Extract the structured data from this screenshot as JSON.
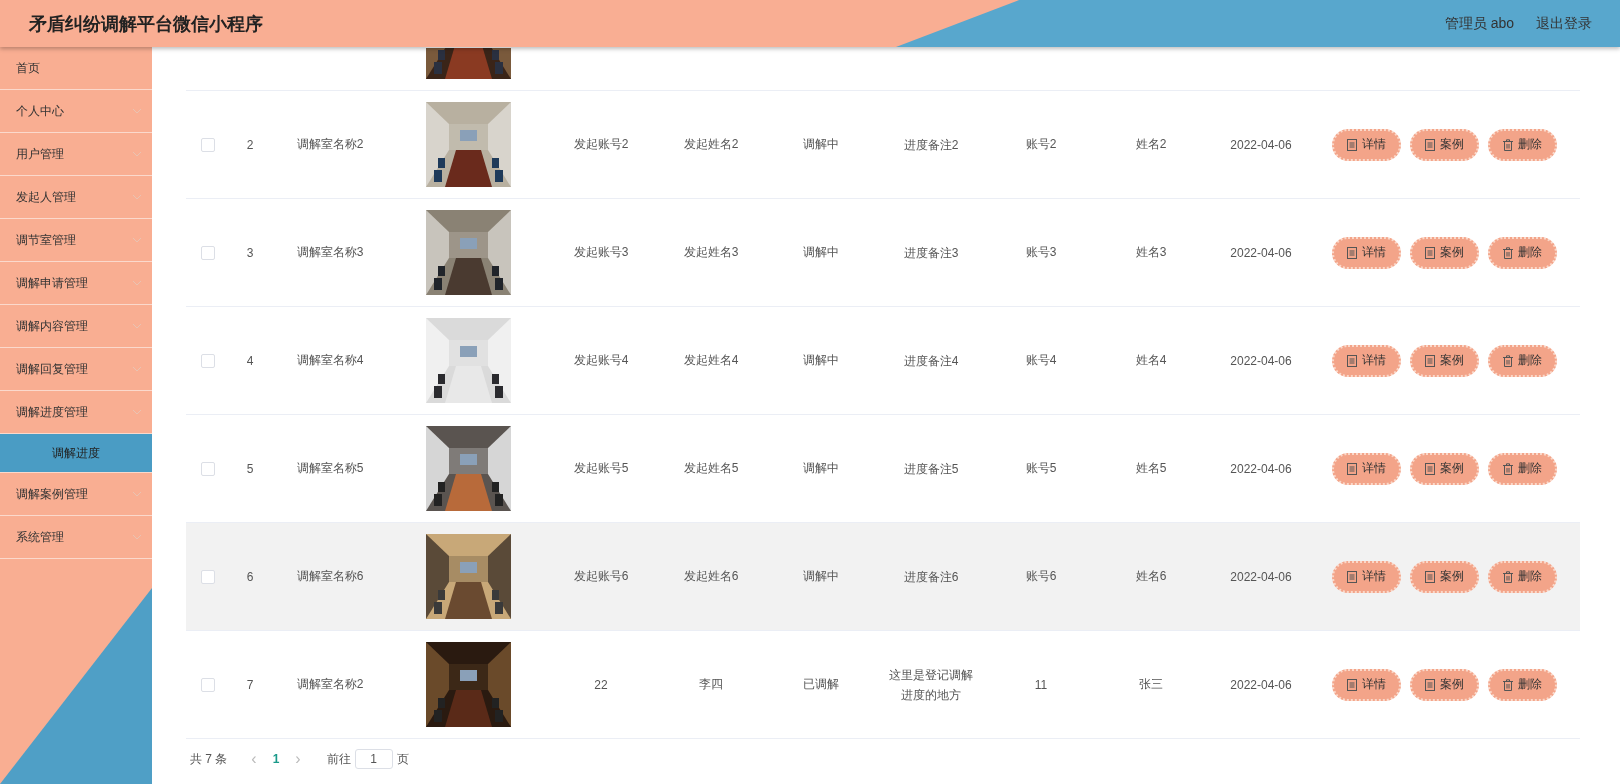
{
  "header": {
    "title": "矛盾纠纷调解平台微信小程序",
    "user": "管理员 abo",
    "logout": "退出登录"
  },
  "sidebar": {
    "items": [
      {
        "label": "首页",
        "expandable": false,
        "selected": false
      },
      {
        "label": "个人中心",
        "expandable": true,
        "selected": false
      },
      {
        "label": "用户管理",
        "expandable": true,
        "selected": false
      },
      {
        "label": "发起人管理",
        "expandable": true,
        "selected": false
      },
      {
        "label": "调节室管理",
        "expandable": true,
        "selected": false
      },
      {
        "label": "调解申请管理",
        "expandable": true,
        "selected": false
      },
      {
        "label": "调解内容管理",
        "expandable": true,
        "selected": false
      },
      {
        "label": "调解回复管理",
        "expandable": true,
        "selected": false
      },
      {
        "label": "调解进度管理",
        "expandable": true,
        "selected": false,
        "children": [
          {
            "label": "调解进度",
            "selected": true
          }
        ]
      },
      {
        "label": "调解案例管理",
        "expandable": true,
        "selected": false
      },
      {
        "label": "系统管理",
        "expandable": true,
        "selected": false
      }
    ]
  },
  "table": {
    "rows": [
      {
        "checked": false,
        "highlighted": false,
        "index": "2",
        "room": "调解室名称2",
        "initiator_account": "发起账号2",
        "initiator_name": "发起姓名2",
        "status": "调解中",
        "note": "进度备注2",
        "account": "账号2",
        "name": "姓名2",
        "date": "2022-04-06",
        "actions": [
          "详情",
          "案例",
          "删除"
        ]
      },
      {
        "checked": false,
        "highlighted": false,
        "index": "3",
        "room": "调解室名称3",
        "initiator_account": "发起账号3",
        "initiator_name": "发起姓名3",
        "status": "调解中",
        "note": "进度备注3",
        "account": "账号3",
        "name": "姓名3",
        "date": "2022-04-06",
        "actions": [
          "详情",
          "案例",
          "删除"
        ]
      },
      {
        "checked": false,
        "highlighted": false,
        "index": "4",
        "room": "调解室名称4",
        "initiator_account": "发起账号4",
        "initiator_name": "发起姓名4",
        "status": "调解中",
        "note": "进度备注4",
        "account": "账号4",
        "name": "姓名4",
        "date": "2022-04-06",
        "actions": [
          "详情",
          "案例",
          "删除"
        ]
      },
      {
        "checked": false,
        "highlighted": false,
        "index": "5",
        "room": "调解室名称5",
        "initiator_account": "发起账号5",
        "initiator_name": "发起姓名5",
        "status": "调解中",
        "note": "进度备注5",
        "account": "账号5",
        "name": "姓名5",
        "date": "2022-04-06",
        "actions": [
          "详情",
          "案例",
          "删除"
        ]
      },
      {
        "checked": false,
        "highlighted": true,
        "index": "6",
        "room": "调解室名称6",
        "initiator_account": "发起账号6",
        "initiator_name": "发起姓名6",
        "status": "调解中",
        "note": "进度备注6",
        "account": "账号6",
        "name": "姓名6",
        "date": "2022-04-06",
        "actions": [
          "详情",
          "案例",
          "删除"
        ]
      },
      {
        "checked": false,
        "highlighted": false,
        "index": "7",
        "room": "调解室名称2",
        "initiator_account": "22",
        "initiator_name": "李四",
        "status": "已调解",
        "note": "这里是登记调解进度的地方",
        "account": "11",
        "name": "张三",
        "date": "2022-04-06",
        "actions": [
          "详情",
          "案例",
          "删除"
        ]
      }
    ]
  },
  "pagination": {
    "total": "共 7 条",
    "prev": "‹",
    "pages": [
      {
        "label": "1",
        "selected": true
      }
    ],
    "next": "›",
    "goto": "前往",
    "page_value": "1",
    "page_unit": "页"
  }
}
